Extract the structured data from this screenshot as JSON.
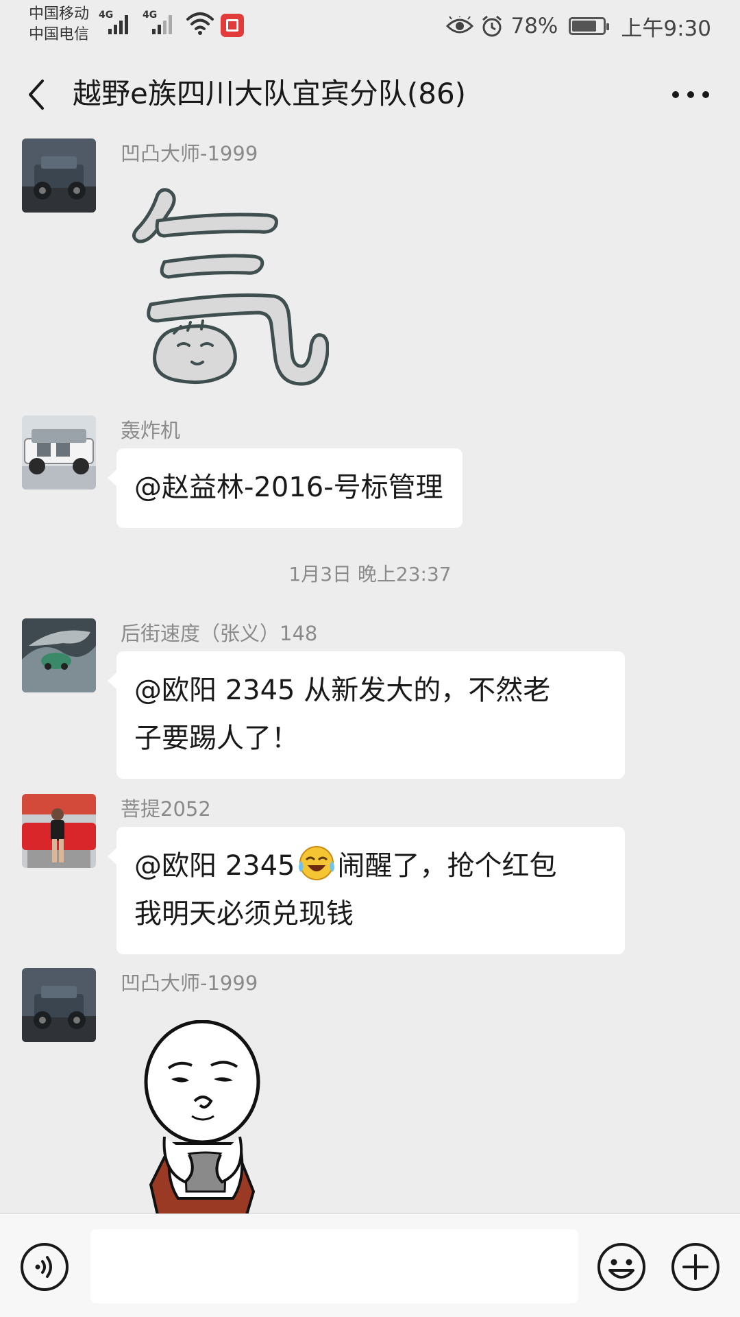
{
  "status_bar": {
    "carrier1": "中国移动",
    "carrier2": "中国电信",
    "net1": "4G",
    "net2": "4G",
    "battery": "78%",
    "battery_level": 0.78,
    "time": "上午9:30"
  },
  "header": {
    "title": "越野e族四川大队宜宾分队(86)"
  },
  "messages": [
    {
      "sender": "凹凸大师-1999",
      "type": "sticker",
      "sticker": "qi-character-sticker"
    },
    {
      "sender": "轰炸机",
      "type": "text",
      "text": "@赵益林-2016-号标管理"
    },
    {
      "type": "timestamp",
      "text": "1月3日 晚上23:37"
    },
    {
      "sender": "后街速度（张义）148",
      "type": "text",
      "line1": "@欧阳 2345  从新发大的，不然老",
      "line2": "子要踢人了！"
    },
    {
      "sender": "菩提2052",
      "type": "text",
      "line1a": "@欧阳 2345",
      "emoji": "laughing-crying-emoji",
      "line1b": "闹醒了，抢个红包",
      "line2": "我明天必须兑现钱"
    },
    {
      "sender": "凹凸大师-1999",
      "type": "sticker",
      "sticker": "meme-face-sticker"
    }
  ],
  "colors": {
    "background": "#ededed",
    "bubble": "#ffffff",
    "secondary_text": "#8a8a8a"
  }
}
